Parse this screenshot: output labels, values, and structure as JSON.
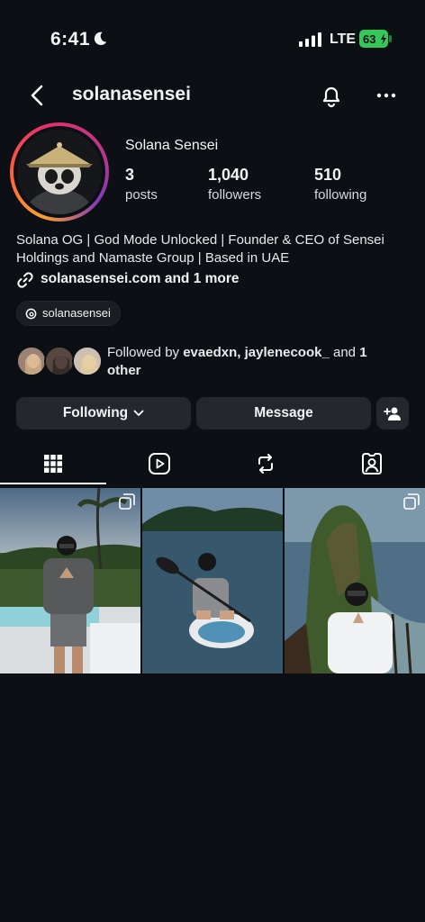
{
  "status_bar": {
    "time": "6:41",
    "network": "LTE",
    "battery": "63"
  },
  "header": {
    "username": "solanasensei"
  },
  "profile": {
    "display_name": "Solana Sensei",
    "stats": [
      {
        "value": "3",
        "label": "posts"
      },
      {
        "value": "1,040",
        "label": "followers"
      },
      {
        "value": "510",
        "label": "following"
      }
    ],
    "bio": "Solana OG | God Mode Unlocked | Founder & CEO of Sensei Holdings and Namaste Group | Based in UAE",
    "link_text": "solanasensei.com and 1 more",
    "threads_handle": "solanasensei"
  },
  "followed_by": {
    "prefix": "Followed by ",
    "names": "evaedxn, jaylenecook_",
    "middle": " and ",
    "suffix": "1 other"
  },
  "actions": {
    "following_label": "Following",
    "message_label": "Message"
  },
  "tabs": [
    "grid-icon",
    "reels-icon",
    "reposts-icon",
    "tagged-icon"
  ],
  "colors": {
    "background": "#0c0f14",
    "button": "#24272d",
    "battery": "#34c759"
  }
}
